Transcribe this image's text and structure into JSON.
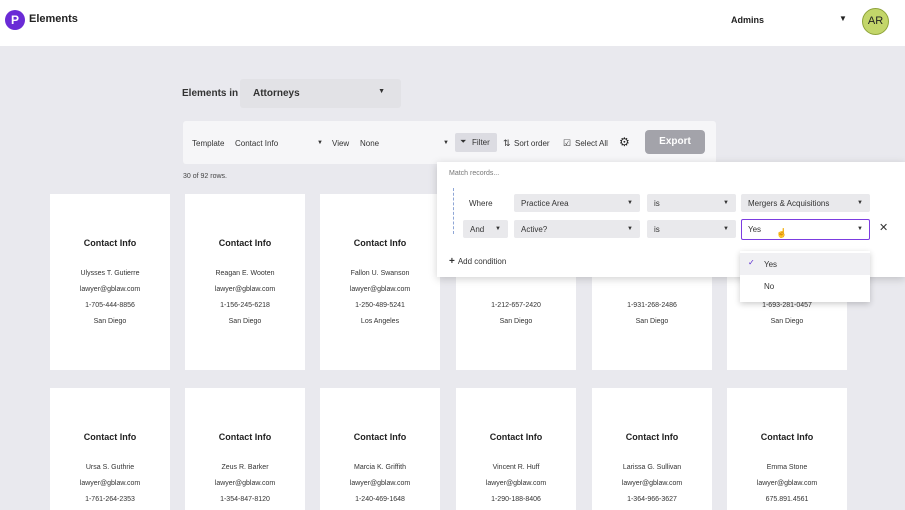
{
  "app": {
    "name": "Elements",
    "logo_letter": "P"
  },
  "header": {
    "org": "Admins",
    "avatar_initials": "AR"
  },
  "collection": {
    "label": "Elements in",
    "value": "Attorneys"
  },
  "toolbar": {
    "template_label": "Template",
    "template_value": "Contact Info",
    "view_label": "View",
    "view_value": "None",
    "filter_label": "Filter",
    "sort_label": "Sort order",
    "select_all_label": "Select All",
    "export_label": "Export"
  },
  "rows_count": "30 of 92 rows.",
  "cards_row1": [
    {
      "title": "Contact Info",
      "name": "Ulysses T. Gutierre",
      "email": "lawyer@gblaw.com",
      "phone": "1-705-444-8856",
      "city": "San Diego"
    },
    {
      "title": "Contact Info",
      "name": "Reagan E. Wooten",
      "email": "lawyer@gblaw.com",
      "phone": "1-156-245-6218",
      "city": "San Diego"
    },
    {
      "title": "Contact Info",
      "name": "Fallon U. Swanson",
      "email": "lawyer@gblaw.com",
      "phone": "1-250-489-5241",
      "city": "Los Angeles"
    },
    {
      "phone": "1-212-657-2420",
      "city": "San Diego"
    },
    {
      "phone": "1-931-268-2486",
      "city": "San Diego"
    },
    {
      "phone": "1-693-281-0457",
      "city": "San Diego"
    }
  ],
  "cards_row2": [
    {
      "title": "Contact Info",
      "name": "Ursa S. Guthrie",
      "email": "lawyer@gblaw.com",
      "phone": "1-761-264-2353"
    },
    {
      "title": "Contact Info",
      "name": "Zeus R. Barker",
      "email": "lawyer@gblaw.com",
      "phone": "1-354-847-8120"
    },
    {
      "title": "Contact Info",
      "name": "Marcia K. Griffith",
      "email": "lawyer@gblaw.com",
      "phone": "1-240-469-1648"
    },
    {
      "title": "Contact Info",
      "name": "Vincent R. Huff",
      "email": "lawyer@gblaw.com",
      "phone": "1-290-188-8406"
    },
    {
      "title": "Contact Info",
      "name": "Larissa G. Sullivan",
      "email": "lawyer@gblaw.com",
      "phone": "1-364-966-3627"
    },
    {
      "title": "Contact Info",
      "name": "Emma Stone",
      "email": "lawyer@gblaw.com",
      "phone": "675.891.4561"
    }
  ],
  "filter_panel": {
    "match_label": "Match records...",
    "conditions": [
      {
        "joiner": "Where",
        "field": "Practice Area",
        "operator": "is",
        "value": "Mergers & Acquisitions"
      },
      {
        "joiner": "And",
        "field": "Active?",
        "operator": "is",
        "value": "Yes"
      }
    ],
    "add_condition_label": "Add condition"
  },
  "value_dropdown": {
    "options": [
      "Yes",
      "No"
    ],
    "selected": "Yes"
  },
  "icons": {
    "caret": "▼",
    "filter": "⏷",
    "sort": "⇅",
    "checkbox": "☑",
    "gear": "⚙",
    "check": "✓",
    "close": "✕",
    "plus": "+",
    "cursor": "☝"
  },
  "colors": {
    "accent": "#6a2bd6",
    "export_bg": "#a3a3aa",
    "avatar_bg": "#c3d66a"
  }
}
